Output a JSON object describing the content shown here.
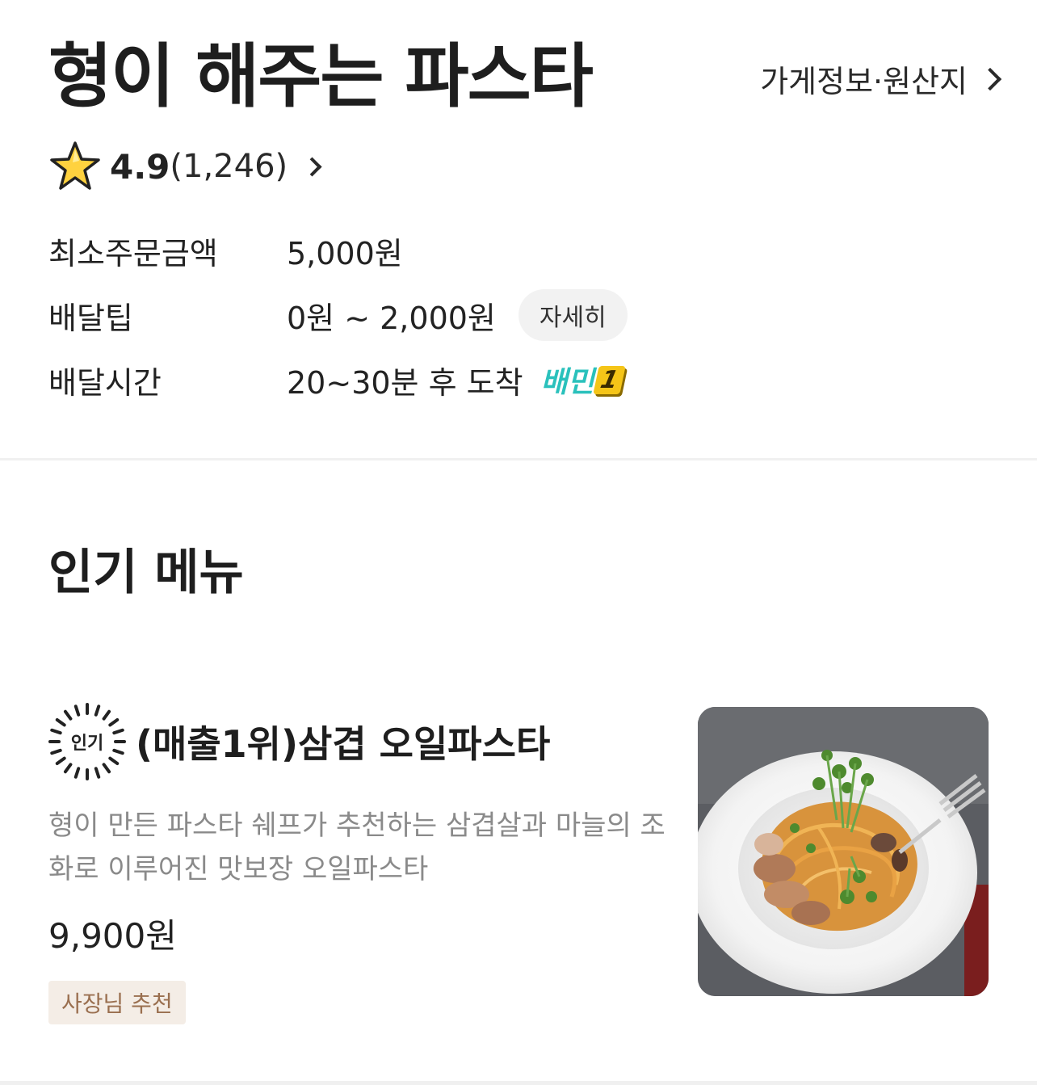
{
  "store": {
    "name": "형이 해주는 파스타",
    "info_link_label": "가게정보·원산지",
    "rating": "4.9",
    "review_count": "(1,246)"
  },
  "info": {
    "rows": [
      {
        "label": "최소주문금액",
        "value": "5,000원"
      },
      {
        "label": "배달팁",
        "value": "0원 ~ 2,000원",
        "button": "자세히"
      },
      {
        "label": "배달시간",
        "value": "20~30분 후 도착",
        "badge_text": "배민",
        "badge_num": "1"
      }
    ]
  },
  "popular_section": {
    "title": "인기 메뉴",
    "items": [
      {
        "badge": "인기",
        "name": "(매출1위)삼겹 오일파스타",
        "description": "형이 만든 파스타 쉐프가 추천하는 삼겹살과 마늘의 조화로 이루어진 맛보장 오일파스타",
        "price": "9,900원",
        "tag": "사장님 추천",
        "image_icon": "pasta-photo"
      }
    ]
  },
  "colors": {
    "accent_mint": "#2ac1bc",
    "tag_bg": "#f4ede6",
    "tag_text": "#9a6f4f",
    "desc_gray": "#8a8a8a"
  }
}
